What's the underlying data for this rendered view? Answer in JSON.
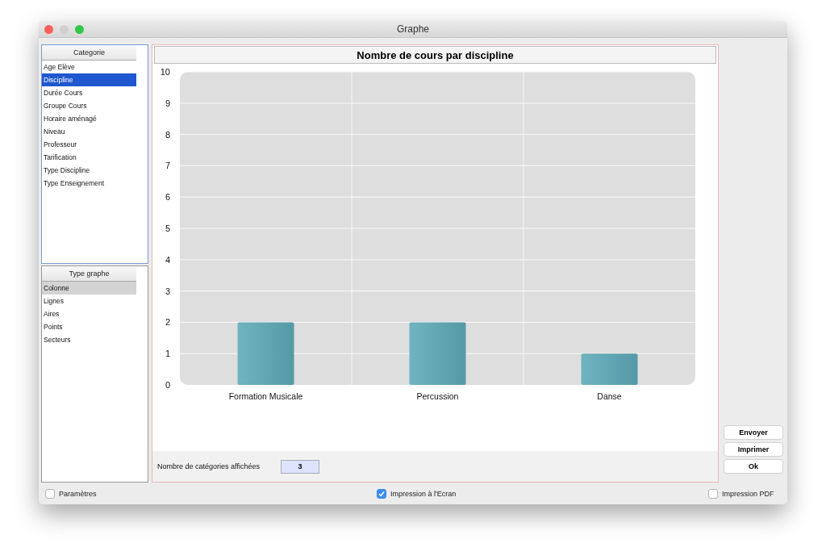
{
  "window": {
    "title": "Graphe"
  },
  "category_list": {
    "header": "Categorie",
    "items": [
      {
        "label": "Age Elève",
        "selected": false
      },
      {
        "label": "Discipline",
        "selected": true
      },
      {
        "label": "Durée Cours",
        "selected": false
      },
      {
        "label": "Groupe Cours",
        "selected": false
      },
      {
        "label": "Horaire aménagé",
        "selected": false
      },
      {
        "label": "Niveau",
        "selected": false
      },
      {
        "label": "Professeur",
        "selected": false
      },
      {
        "label": "Tarification",
        "selected": false
      },
      {
        "label": "Type Discipline",
        "selected": false
      },
      {
        "label": "Type Enseignement",
        "selected": false
      }
    ]
  },
  "chart_type_list": {
    "header": "Type graphe",
    "items": [
      {
        "label": "Colonne",
        "selected": true
      },
      {
        "label": "Lignes",
        "selected": false
      },
      {
        "label": "Aires",
        "selected": false
      },
      {
        "label": "Points",
        "selected": false
      },
      {
        "label": "Secteurs",
        "selected": false
      }
    ]
  },
  "chart": {
    "title": "Nombre de cours par discipline",
    "chart_data": {
      "type": "bar",
      "categories": [
        "Formation Musicale",
        "Percussion",
        "Danse"
      ],
      "values": [
        2,
        2,
        1
      ],
      "ylim": [
        0,
        10
      ],
      "grid": true,
      "yticks": [
        0,
        1,
        2,
        3,
        4,
        5,
        6,
        7,
        8,
        9,
        10
      ]
    }
  },
  "category_count": {
    "label": "Nombre de catégories affichées",
    "value": "3"
  },
  "buttons": [
    "Envoyer",
    "Imprimer",
    "Ok"
  ],
  "options": [
    {
      "label": "Paramètres",
      "checked": false
    },
    {
      "label": "Impression à l'Ecran",
      "checked": true
    },
    {
      "label": "Impression PDF",
      "checked": false
    }
  ]
}
